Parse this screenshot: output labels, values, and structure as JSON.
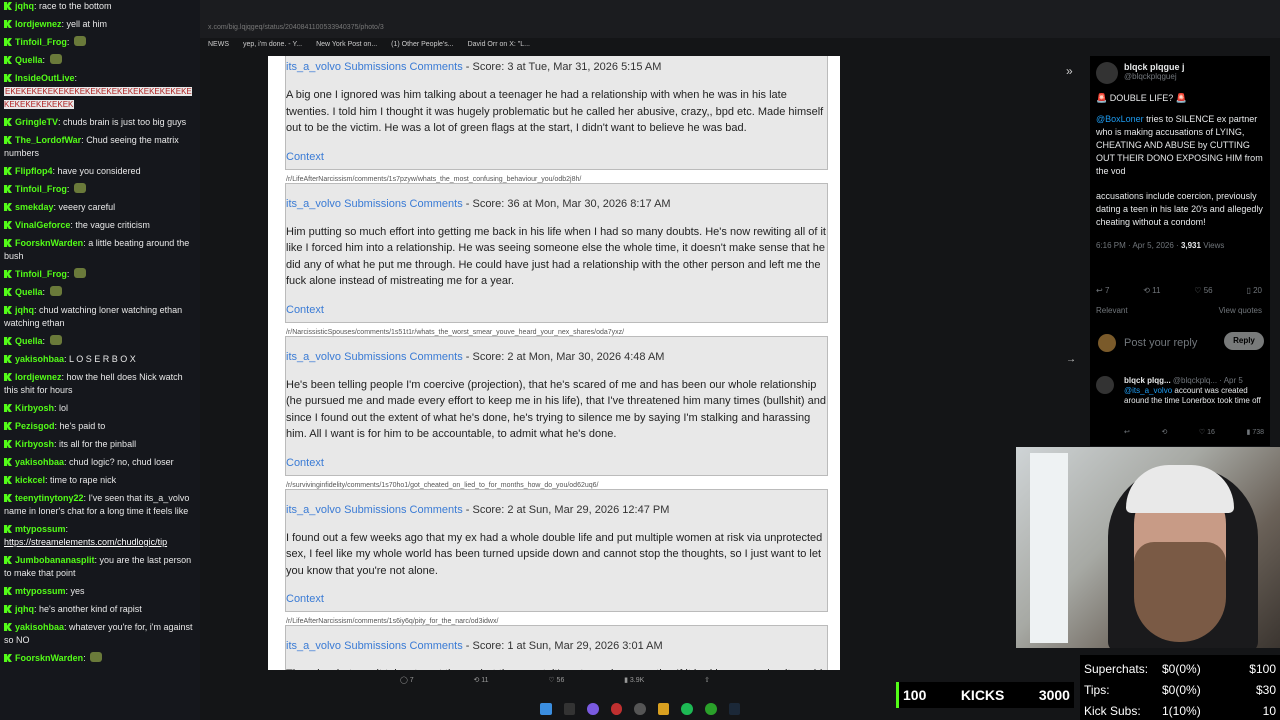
{
  "chat": [
    {
      "user": "jqhq",
      "color": "#53fc18",
      "text": "race to the bottom"
    },
    {
      "user": "lordjewnez",
      "color": "#53fc18",
      "text": "yell at him"
    },
    {
      "user": "Tinfoil_Frog",
      "color": "#53fc18",
      "text": ""
    },
    {
      "user": "Quella",
      "color": "#53fc18",
      "text": ""
    },
    {
      "user": "InsideOutLive",
      "color": "#53fc18",
      "text": "EKEKEKEKEKEKEKEKEKEKEKEKEKEKEKEKEKEKEKEKEKEKEKEK"
    },
    {
      "user": "GringleTV",
      "color": "#53fc18",
      "text": "chuds brain is just too big guys"
    },
    {
      "user": "The_LordofWar",
      "color": "#53fc18",
      "text": "Chud seeing the matrix numbers"
    },
    {
      "user": "Flipflop4",
      "color": "#53fc18",
      "text": "have you considered"
    },
    {
      "user": "Tinfoil_Frog",
      "color": "#53fc18",
      "text": ""
    },
    {
      "user": "smekday",
      "color": "#53fc18",
      "text": "veeery careful"
    },
    {
      "user": "VinalGeforce",
      "color": "#53fc18",
      "text": "the vague criticism"
    },
    {
      "user": "FoorsknWarden",
      "color": "#53fc18",
      "text": "a little beating around the bush"
    },
    {
      "user": "Tinfoil_Frog",
      "color": "#53fc18",
      "text": ""
    },
    {
      "user": "Quella",
      "color": "#53fc18",
      "text": ""
    },
    {
      "user": "jqhq",
      "color": "#53fc18",
      "text": "chud watching loner watching ethan watching ethan"
    },
    {
      "user": "Quella",
      "color": "#53fc18",
      "text": ""
    },
    {
      "user": "yakisohbaa",
      "color": "#53fc18",
      "text": "L O S E R B O X"
    },
    {
      "user": "lordjewnez",
      "color": "#53fc18",
      "text": "how the hell does Nick watch this shit for hours"
    },
    {
      "user": "Kirbyosh",
      "color": "#53fc18",
      "text": "lol"
    },
    {
      "user": "Pezisgod",
      "color": "#53fc18",
      "text": "he's paid to"
    },
    {
      "user": "Kirbyosh",
      "color": "#53fc18",
      "text": "its all for the pinball"
    },
    {
      "user": "yakisohbaa",
      "color": "#53fc18",
      "text": "chud logic? no, chud loser"
    },
    {
      "user": "kickcel",
      "color": "#53fc18",
      "text": "time to rape nick"
    },
    {
      "user": "teenytinytony22",
      "color": "#53fc18",
      "text": "I've seen that its_a_volvo name in loner's chat for a long time it feels like"
    },
    {
      "user": "mtypossum",
      "color": "#53fc18",
      "text": "https://streamelements.com/chudlogic/tip",
      "link": true
    },
    {
      "user": "Jumbobananasplit",
      "color": "#53fc18",
      "text": "you are the last person to make that point"
    },
    {
      "user": "mtypossum",
      "color": "#53fc18",
      "text": "yes"
    },
    {
      "user": "jqhq",
      "color": "#53fc18",
      "text": "he's another kind of rapist"
    },
    {
      "user": "yakisohbaa",
      "color": "#53fc18",
      "text": "whatever you're for, i'm against so NO"
    },
    {
      "user": "FoorsknWarden",
      "color": "#53fc18",
      "text": ""
    }
  ],
  "bookmarks": [
    "NEWS",
    "yep, i'm done. - Y...",
    "New York Post on...",
    "(1) Other People's...",
    "David Orr on X: \"L..."
  ],
  "urlbar": "x.com/big.lqjqgeq/status/2040841100533940375/photo/3",
  "posts": [
    {
      "url": "",
      "meta_user": "its_a_volvo",
      "meta_links": "Submissions Comments",
      "meta_score": " - Score: 3 at Tue, Mar 31, 2026 5:15 AM",
      "body": "A big one I ignored was him talking about a teenager he had a relationship with when he was in his late twenties. I told him I thought it was hugely problematic but he called her abusive, crazy,, bpd etc. Made himself out to be the victim. He was a lot of green flags at the start, I didn't want to believe he was bad.",
      "context": "Context"
    },
    {
      "url": "/r/LifeAfterNarcissism/comments/1s7pzyw/whats_the_most_confusing_behaviour_you/odb2j8h/",
      "meta_user": "its_a_volvo",
      "meta_links": "Submissions Comments",
      "meta_score": " - Score: 36 at Mon, Mar 30, 2026 8:17 AM",
      "body": "Him putting so much effort into getting me back in his life when I had so many doubts. He's now rewiting all of it like I forced him into a relationship. He was seeing someone else the whole time, it doesn't make sense that he did any of what he put me through. He could have just had a relationship with the other person and left me the fuck alone instead of mistreating me for a year.",
      "context": "Context"
    },
    {
      "url": "/r/NarcissisticSpouses/comments/1s51t1r/whats_the_worst_smear_youve_heard_your_nex_shares/oda7yxz/",
      "meta_user": "its_a_volvo",
      "meta_links": "Submissions Comments",
      "meta_score": " - Score: 2 at Mon, Mar 30, 2026 4:48 AM",
      "body": "He's been telling people I'm coercive (projection), that he's scared of me and has been our whole relationship (he pursued me and made every effort to keep me in his life), that I've threatened him many times (bullshit) and since I found out the extent of what he's done, he's trying to silence me by saying I'm stalking and harassing him. All I want is for him to be accountable, to admit what he's done.",
      "context": "Context"
    },
    {
      "url": "/r/survivinginfidelity/comments/1s70ho1/got_cheated_on_lied_to_for_months_how_do_you/od62uq6/",
      "meta_user": "its_a_volvo",
      "meta_links": "Submissions Comments",
      "meta_score": " - Score: 2 at Sun, Mar 29, 2026 12:47 PM",
      "body": "I found out a few weeks ago that my ex had a whole double life and put multiple women at risk via unprotected sex, I feel like my whole world has been turned upside down and cannot stop the thoughts, so I just want to let you know that you're not alone.",
      "context": "Context"
    },
    {
      "url": "/r/LifeAfterNarcissism/comments/1s6iy6q/pity_for_the_narc/od3idwx/",
      "meta_user": "its_a_volvo",
      "meta_links": "Submissions Comments",
      "meta_score": " - Score: 1 at Sun, Mar 29, 2026 3:01 AM",
      "body": "They do whatever it takes to get them what they want, it's not genuine empathy. If it had been genuine it would have been ongoing.",
      "context": ""
    }
  ],
  "tweet": {
    "name": "blqck plqgue j",
    "handle": "@blqckplqguej",
    "headline": "🚨 DOUBLE LIFE? 🚨",
    "mention": "@BoxLoner",
    "text1": " tries to SILENCE ex partner who is making accusations of LYING, CHEATING AND ABUSE by CUTTING OUT THEIR DONO EXPOSING HIM from the vod",
    "text2": "accusations include coercion, previously dating a teen in his late 20's and allegedly cheating without a condom!",
    "time": "6:16 PM · Apr 5, 2026 · ",
    "views": "3,931",
    "views_label": " Views",
    "replies": "7",
    "retweets": "11",
    "likes": "56",
    "bookmarks": "20",
    "sort": "Relevant",
    "view_quotes": "View quotes",
    "reply_placeholder": "Post your reply",
    "reply_button": "Reply",
    "reply_name": "blqck plqg...",
    "reply_handle": "@blqckplq... · Apr 5",
    "reply_mention": "@its_a_volvo",
    "reply_text": " account was created around the time Lonerbox took time off",
    "reply_likes": "16",
    "reply_views": "738"
  },
  "kicks": {
    "left": "100",
    "label": "KICKS",
    "right": "3000"
  },
  "stats": [
    {
      "label": "Superchats:",
      "value": "$0(0%)",
      "goal": "$100"
    },
    {
      "label": "Tips:",
      "value": "$0(0%)",
      "goal": "$30"
    },
    {
      "label": "Kick Subs:",
      "value": "1(10%)",
      "goal": "10"
    }
  ],
  "actions": [
    "7",
    "11",
    "56",
    "3.9K",
    ""
  ],
  "colors": {
    "accent": "#53fc18",
    "link": "#3a7bd5",
    "twitter_blue": "#1d9bf0"
  }
}
